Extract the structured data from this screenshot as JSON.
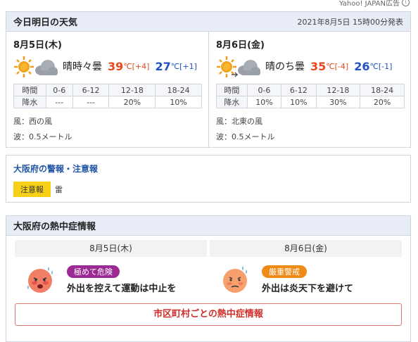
{
  "ad_label": "Yahoo! JAPAN広告",
  "forecast": {
    "title": "今日明日の天気",
    "announced": "2021年8月5日 15時00分発表",
    "days": [
      {
        "date": "8月5日(木)",
        "icon": "sun-cloud-icon",
        "weather": "晴時々曇",
        "high": "39",
        "high_unit": "℃",
        "high_diff": "[+4]",
        "low": "27",
        "low_unit": "℃",
        "low_diff": "[+1]",
        "rain_header": [
          "時間",
          "0-6",
          "6-12",
          "12-18",
          "18-24"
        ],
        "rain_values": [
          "降水",
          "---",
          "---",
          "20%",
          "10%"
        ],
        "wind": "風：西の風",
        "wave": "波：0.5メートル"
      },
      {
        "date": "8月6日(金)",
        "icon": "sun-then-cloud-icon",
        "weather": "晴のち曇",
        "high": "35",
        "high_unit": "℃",
        "high_diff": "[-4]",
        "low": "26",
        "low_unit": "℃",
        "low_diff": "[-1]",
        "rain_header": [
          "時間",
          "0-6",
          "6-12",
          "12-18",
          "18-24"
        ],
        "rain_values": [
          "降水",
          "10%",
          "10%",
          "30%",
          "20%"
        ],
        "wind": "風：北東の風",
        "wave": "波：0.5メートル"
      }
    ]
  },
  "warnings": {
    "title": "大阪府の警報・注意報",
    "badge": "注意報",
    "item": "雷"
  },
  "heatstroke": {
    "title": "大阪府の熱中症情報",
    "days": [
      {
        "date": "8月5日(木)",
        "level": "極めて危険",
        "level_color": "#9b2a93",
        "message": "外出を控えて運動は中止を"
      },
      {
        "date": "8月6日(金)",
        "level": "厳重警戒",
        "level_color": "#ef8a17",
        "message": "外出は炎天下を避けて"
      }
    ],
    "link": "市区町村ごとの熱中症情報"
  }
}
